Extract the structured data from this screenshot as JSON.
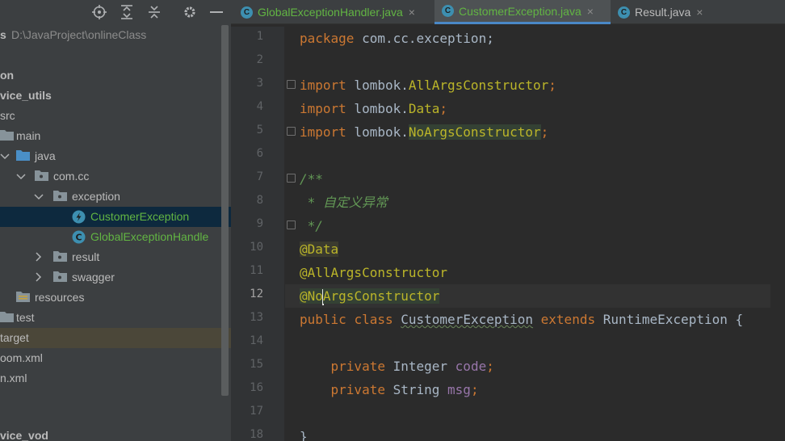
{
  "project_panel": {
    "toolbar": {
      "locate_icon": "crosshair-icon",
      "expand_icon": "expand-all-icon",
      "collapse_icon": "collapse-all-icon",
      "settings_icon": "gear-icon",
      "hide_icon": "minimize-icon"
    },
    "tree": [
      {
        "label": "s",
        "sub": "D:\\JavaProject\\onlineClass"
      },
      {
        "label": "on"
      },
      {
        "label": "vice_utils"
      },
      {
        "label": "src"
      },
      {
        "label": "main"
      },
      {
        "label": "java"
      },
      {
        "label": "com.cc"
      },
      {
        "label": "exception"
      },
      {
        "label": "CustomerException"
      },
      {
        "label": "GlobalExceptionHandle"
      },
      {
        "label": "result"
      },
      {
        "label": "swagger"
      },
      {
        "label": "resources"
      },
      {
        "label": "test"
      },
      {
        "label": "target"
      },
      {
        "label": "oom.xml"
      },
      {
        "label": "n.xml"
      },
      {
        "label": "vice_vod"
      }
    ]
  },
  "editor": {
    "tabs": [
      {
        "label": "GlobalExceptionHandler.java",
        "close": "×"
      },
      {
        "label": "CustomerException.java",
        "close": "×"
      },
      {
        "label": "Result.java",
        "close": "×"
      }
    ],
    "line_numbers": [
      "1",
      "2",
      "3",
      "4",
      "5",
      "6",
      "7",
      "8",
      "9",
      "10",
      "11",
      "12",
      "13",
      "14",
      "15",
      "16",
      "17",
      "18"
    ],
    "code": {
      "l1_kw": "package",
      "l1_rest": " com.cc.exception;",
      "l3_kw": "import",
      "l3_a": " lombok.",
      "l3_b": "AllArgsConstructor",
      "l3_c": ";",
      "l4_kw": "import",
      "l4_a": " lombok.",
      "l4_b": "Data",
      "l4_c": ";",
      "l5_kw": "import",
      "l5_a": " lombok.",
      "l5_b": "NoArgsConstructor",
      "l5_c": ";",
      "l7": "/**",
      "l8": " * 自定义异常",
      "l9": " */",
      "l10": "@Data",
      "l11": "@AllArgsConstructor",
      "l12_a": "@No",
      "l12_b": "ArgsConstructor",
      "l13_kw1": "public",
      "l13_kw2": "class",
      "l13_name": "CustomerException",
      "l13_kw3": "extends",
      "l13_rest": " RuntimeException {",
      "l15_kw": "    private",
      "l15_type": " Integer ",
      "l15_field": "code",
      "l15_end": ";",
      "l16_kw": "    private",
      "l16_type": " String ",
      "l16_field": "msg",
      "l16_end": ";",
      "l18": "}"
    }
  }
}
